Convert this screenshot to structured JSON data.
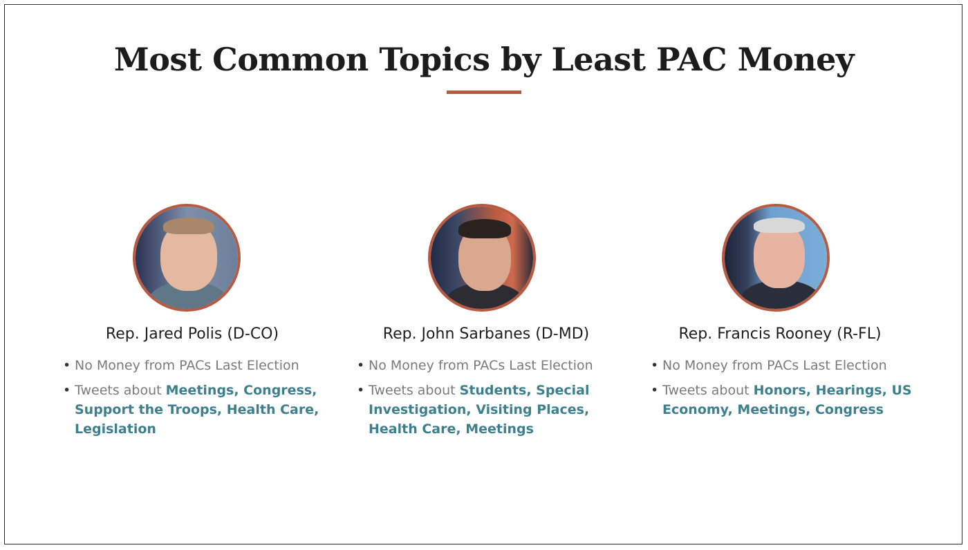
{
  "title": "Most Common Topics by Least PAC Money",
  "colors": {
    "accent": "#b85a41",
    "topic_link": "#3e7f8e",
    "muted_text": "#7a7a7a",
    "heading_text": "#1c1c1c"
  },
  "representatives": [
    {
      "name": "Rep. Jared Polis (D-CO)",
      "photo": "portrait-photo",
      "pac_line": "No Money from PACs Last Election",
      "tweets_prefix": "Tweets about",
      "topics": "Meetings, Congress, Support the Troops, Health Care, Legislation"
    },
    {
      "name": "Rep. John  Sarbanes (D-MD)",
      "photo": "portrait-photo",
      "pac_line": "No Money from PACs Last Election",
      "tweets_prefix": "Tweets about",
      "topics": "Students, Special Investigation, Visiting Places, Health Care, Meetings"
    },
    {
      "name": "Rep. Francis Rooney (R-FL)",
      "photo": "portrait-photo",
      "pac_line": "No Money from PACs Last Election",
      "tweets_prefix": "Tweets about",
      "topics": "Honors, Hearings, US Economy, Meetings, Congress"
    }
  ]
}
